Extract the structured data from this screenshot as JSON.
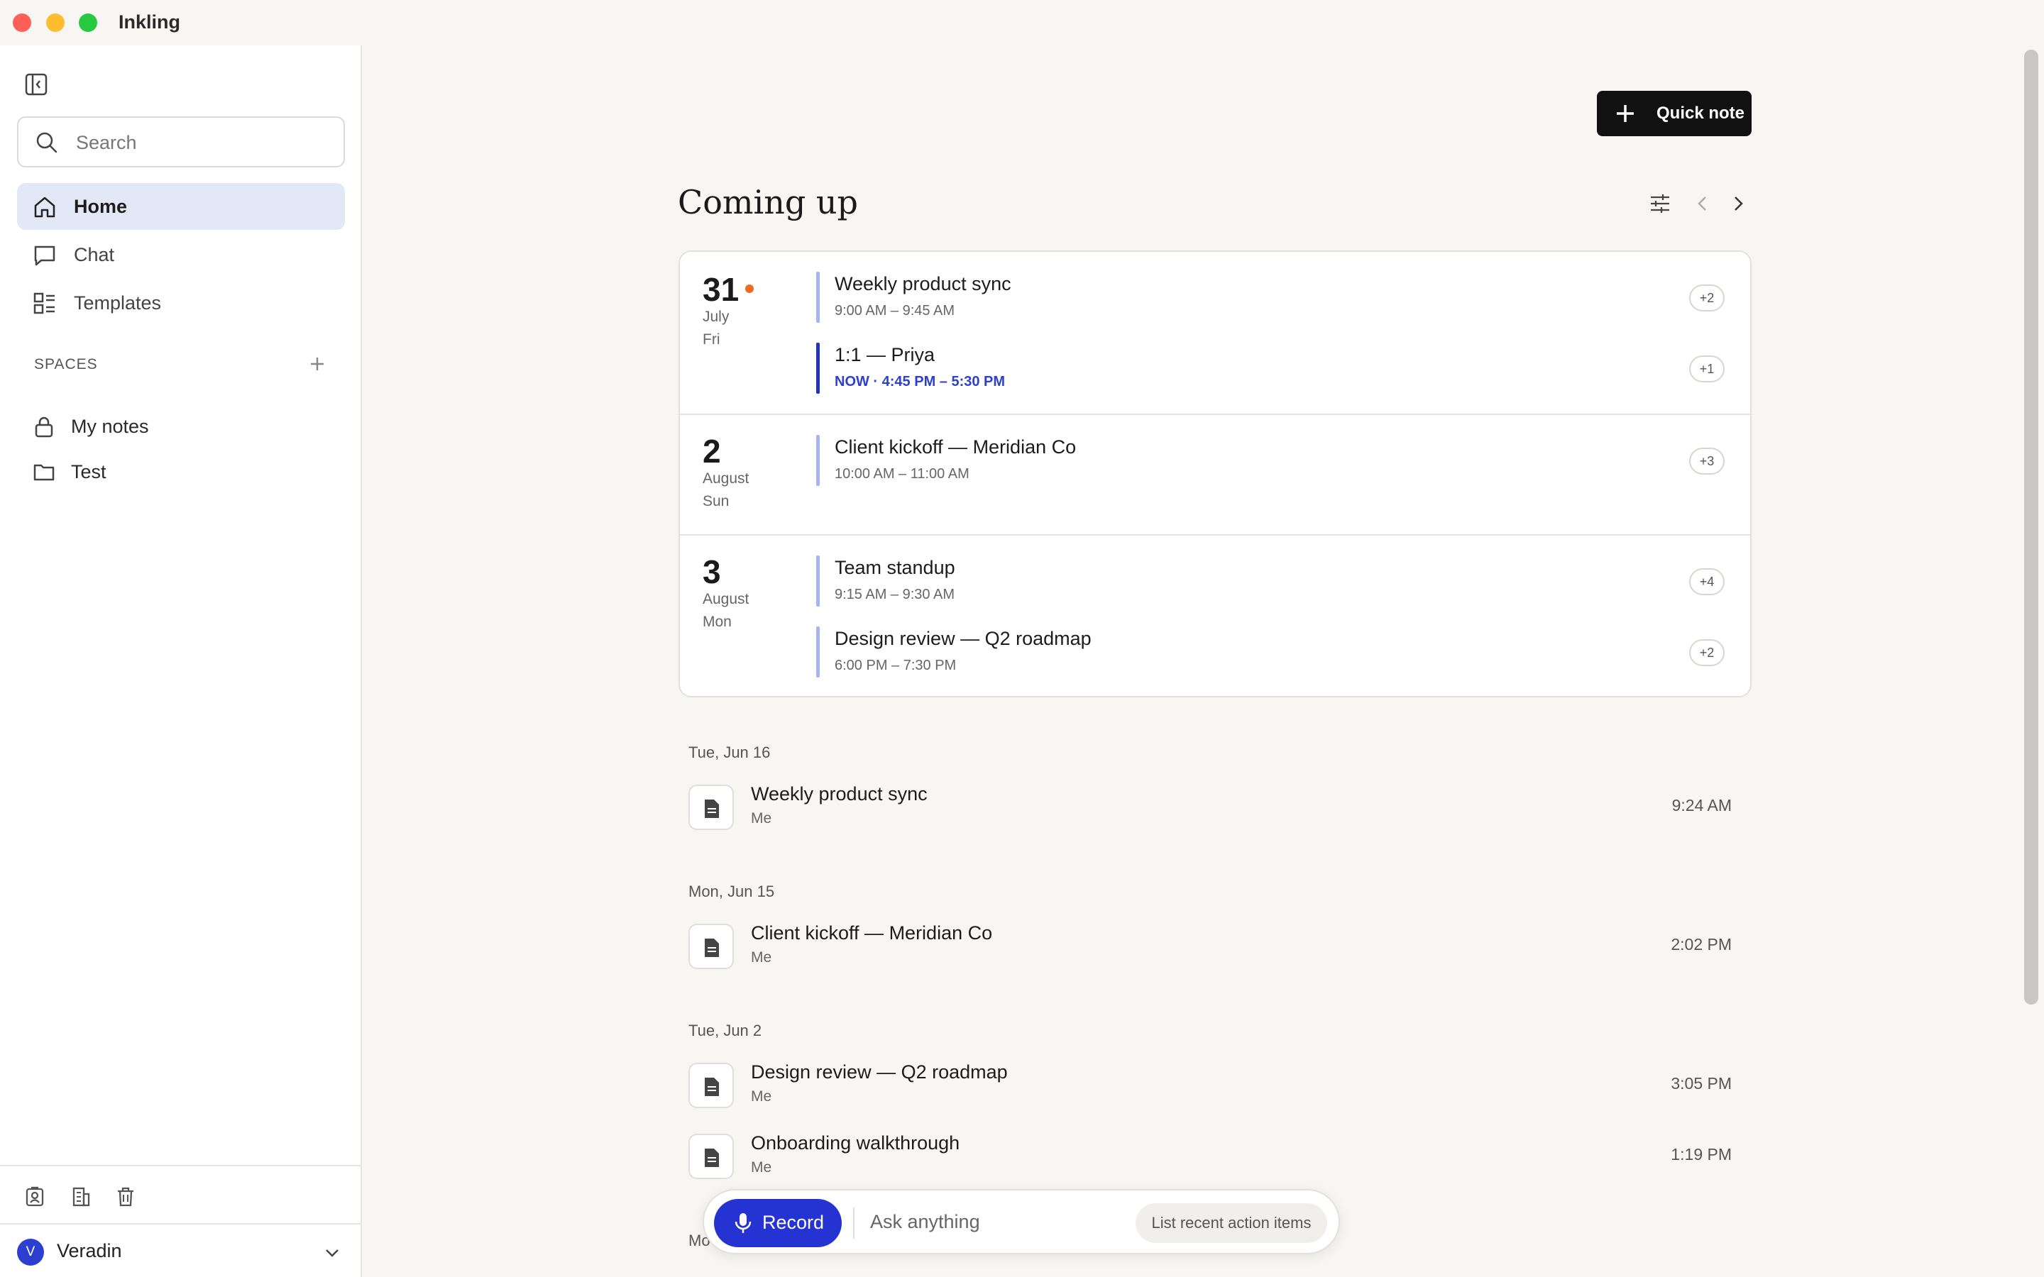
{
  "app": {
    "title": "Inkling"
  },
  "sidebar": {
    "search_placeholder": "Search",
    "nav": [
      {
        "label": "Home",
        "icon": "home-icon",
        "active": true
      },
      {
        "label": "Chat",
        "icon": "chat-icon",
        "active": false
      },
      {
        "label": "Templates",
        "icon": "templates-icon",
        "active": false
      }
    ],
    "spaces_label": "SPACES",
    "spaces": [
      {
        "label": "My notes",
        "icon": "lock-icon"
      },
      {
        "label": "Test",
        "icon": "folder-icon"
      }
    ],
    "user": {
      "initial": "V",
      "name": "Veradin"
    }
  },
  "main": {
    "quick_note_label": "Quick note",
    "title": "Coming up",
    "days": [
      {
        "day": "31",
        "month": "July",
        "weekday": "Fri",
        "today": true,
        "events": [
          {
            "name": "Weekly product sync",
            "time": "9:00 AM – 9:45 AM",
            "badge": "+2",
            "now": false
          },
          {
            "name": "1:1 — Priya",
            "time": "NOW · 4:45 PM – 5:30 PM",
            "badge": "+1",
            "now": true
          }
        ]
      },
      {
        "day": "2",
        "month": "August",
        "weekday": "Sun",
        "today": false,
        "events": [
          {
            "name": "Client kickoff — Meridian Co",
            "time": "10:00 AM – 11:00 AM",
            "badge": "+3",
            "now": false
          }
        ]
      },
      {
        "day": "3",
        "month": "August",
        "weekday": "Mon",
        "today": false,
        "events": [
          {
            "name": "Team standup",
            "time": "9:15 AM – 9:30 AM",
            "badge": "+4",
            "now": false
          },
          {
            "name": "Design review — Q2 roadmap",
            "time": "6:00 PM – 7:30 PM",
            "badge": "+2",
            "now": false
          }
        ]
      }
    ],
    "recent": [
      {
        "date": "Tue, Jun 16",
        "notes": [
          {
            "title": "Weekly product sync",
            "who": "Me",
            "time": "9:24 AM"
          }
        ]
      },
      {
        "date": "Mon, Jun 15",
        "notes": [
          {
            "title": "Client kickoff — Meridian Co",
            "who": "Me",
            "time": "2:02 PM"
          }
        ]
      },
      {
        "date": "Tue, Jun 2",
        "notes": [
          {
            "title": "Design review — Q2 roadmap",
            "who": "Me",
            "time": "3:05 PM"
          },
          {
            "title": "Onboarding walkthrough",
            "who": "Me",
            "time": "1:19 PM"
          }
        ]
      }
    ],
    "partial_date": "Mo"
  },
  "composer": {
    "record_label": "Record",
    "ask_placeholder": "Ask anything",
    "suggestion": "List recent action items"
  },
  "colors": {
    "accent": "#2533d3",
    "now": "#2c3fd0",
    "today_dot": "#f06a22",
    "event_bar": "#a8b4ee"
  }
}
